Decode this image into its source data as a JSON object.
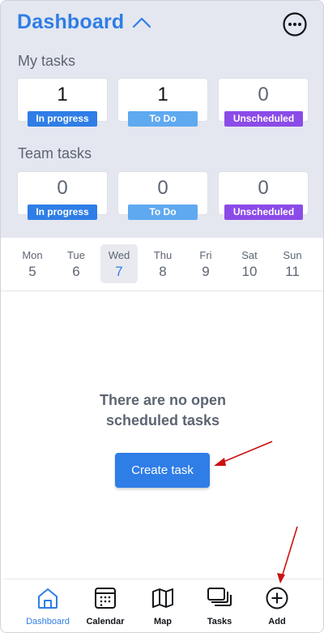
{
  "header": {
    "title": "Dashboard",
    "menu_icon": "chevron-up-icon",
    "more_icon": "more-horizontal-icon"
  },
  "my_tasks": {
    "label": "My tasks",
    "cards": [
      {
        "count": "1",
        "status": "In progress"
      },
      {
        "count": "1",
        "status": "To Do"
      },
      {
        "count": "0",
        "status": "Unscheduled"
      }
    ]
  },
  "team_tasks": {
    "label": "Team tasks",
    "cards": [
      {
        "count": "0",
        "status": "In progress"
      },
      {
        "count": "0",
        "status": "To Do"
      },
      {
        "count": "0",
        "status": "Unscheduled"
      }
    ]
  },
  "week": {
    "days": [
      {
        "name": "Mon",
        "date": "5"
      },
      {
        "name": "Tue",
        "date": "6"
      },
      {
        "name": "Wed",
        "date": "7"
      },
      {
        "name": "Thu",
        "date": "8"
      },
      {
        "name": "Fri",
        "date": "9"
      },
      {
        "name": "Sat",
        "date": "10"
      },
      {
        "name": "Sun",
        "date": "11"
      }
    ],
    "selected": "Wed"
  },
  "empty_state": {
    "line1": "There are no open",
    "line2": "scheduled tasks",
    "button": "Create task"
  },
  "tabbar": {
    "items": [
      {
        "label": "Dashboard",
        "icon": "home-icon"
      },
      {
        "label": "Calendar",
        "icon": "calendar-icon"
      },
      {
        "label": "Map",
        "icon": "map-icon"
      },
      {
        "label": "Tasks",
        "icon": "tasks-icon"
      },
      {
        "label": "Add",
        "icon": "plus-circle-icon"
      }
    ],
    "active": "Dashboard"
  },
  "colors": {
    "accent": "#2f7de6",
    "todo": "#5fa9f0",
    "unscheduled": "#8b4be8",
    "annotation": "#cc1111"
  }
}
